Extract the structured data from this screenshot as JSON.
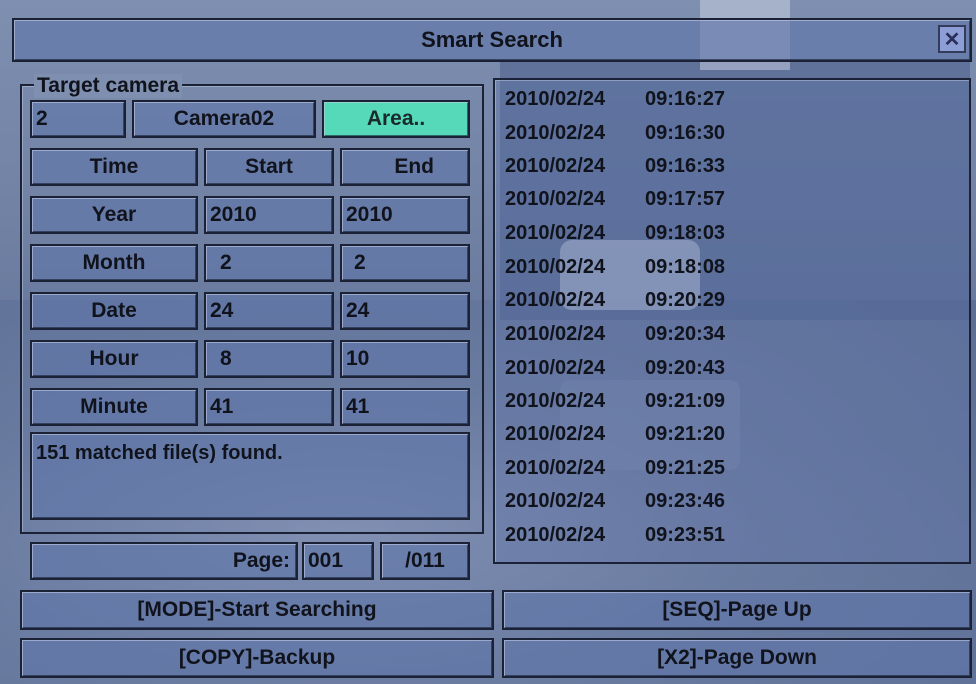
{
  "title": "Smart Search",
  "target_camera": {
    "label": "Target camera",
    "number": "2",
    "name": "Camera02",
    "area_button": "Area.."
  },
  "headers": {
    "time": "Time",
    "start": "Start",
    "end": "End"
  },
  "fields": [
    {
      "label": "Year",
      "start": "2010",
      "end": "2010"
    },
    {
      "label": "Month",
      "start": "2",
      "end": "2"
    },
    {
      "label": "Date",
      "start": "24",
      "end": "24"
    },
    {
      "label": "Hour",
      "start": "8",
      "end": "10"
    },
    {
      "label": "Minute",
      "start": "41",
      "end": "41"
    }
  ],
  "status_text": "151 matched file(s) found.",
  "page": {
    "label": "Page:",
    "current": "001",
    "total": "/011"
  },
  "results": [
    {
      "date": "2010/02/24",
      "time": "09:16:27"
    },
    {
      "date": "2010/02/24",
      "time": "09:16:30"
    },
    {
      "date": "2010/02/24",
      "time": "09:16:33"
    },
    {
      "date": "2010/02/24",
      "time": "09:17:57"
    },
    {
      "date": "2010/02/24",
      "time": "09:18:03"
    },
    {
      "date": "2010/02/24",
      "time": "09:18:08"
    },
    {
      "date": "2010/02/24",
      "time": "09:20:29"
    },
    {
      "date": "2010/02/24",
      "time": "09:20:34"
    },
    {
      "date": "2010/02/24",
      "time": "09:20:43"
    },
    {
      "date": "2010/02/24",
      "time": "09:21:09"
    },
    {
      "date": "2010/02/24",
      "time": "09:21:20"
    },
    {
      "date": "2010/02/24",
      "time": "09:21:25"
    },
    {
      "date": "2010/02/24",
      "time": "09:23:46"
    },
    {
      "date": "2010/02/24",
      "time": "09:23:51"
    }
  ],
  "buttons": {
    "start_searching": "[MODE]-Start Searching",
    "page_up": "[SEQ]-Page Up",
    "backup": "[COPY]-Backup",
    "page_down": "[X2]-Page Down"
  },
  "colors": {
    "accent": "#56d9b8",
    "panel": "#6076aa",
    "border": "#1c2236"
  },
  "icons": {
    "close": "close-icon"
  }
}
